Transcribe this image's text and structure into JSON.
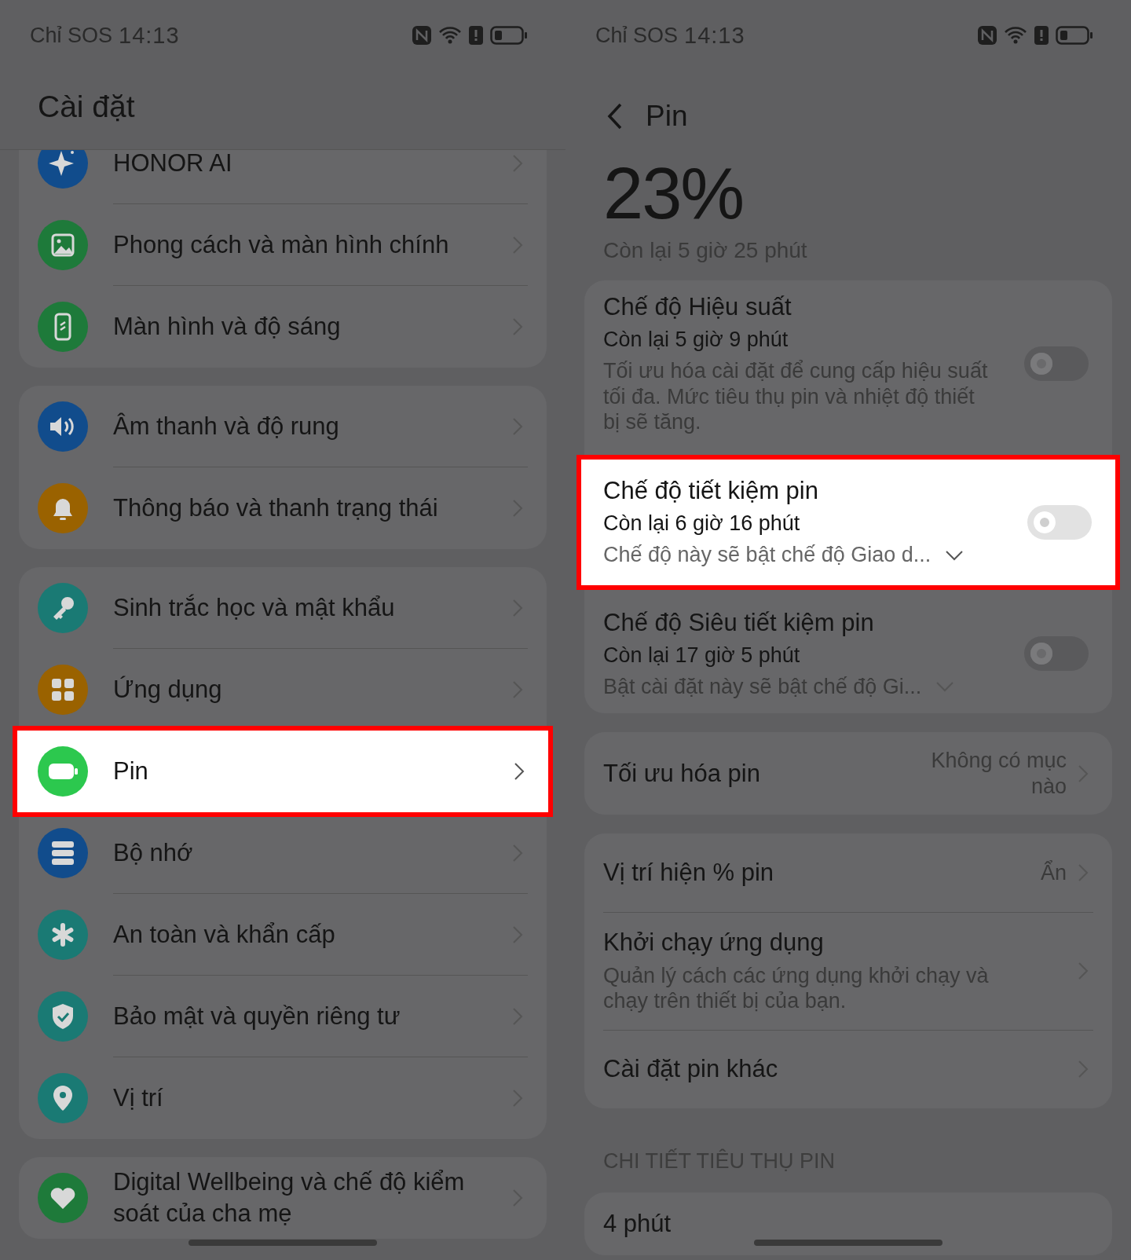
{
  "left": {
    "status": {
      "carrier": "Chỉ SOS",
      "time": "14:13"
    },
    "title": "Cài đặt",
    "groups": [
      {
        "items": [
          {
            "label": "HONOR AI",
            "kind": "sparkle",
            "color": "#114c8c",
            "highlighted": false
          },
          {
            "label": "Phong cách và màn hình chính",
            "kind": "image",
            "color": "#1e7a3a",
            "highlighted": false
          },
          {
            "label": "Màn hình và độ sáng",
            "kind": "phone",
            "color": "#1e7a3a",
            "highlighted": false
          }
        ]
      },
      {
        "items": [
          {
            "label": "Âm thanh và độ rung",
            "kind": "speaker",
            "color": "#114c8c",
            "highlighted": false
          },
          {
            "label": "Thông báo và thanh trạng thái",
            "kind": "bell",
            "color": "#9a6200",
            "highlighted": false
          }
        ]
      },
      {
        "items": [
          {
            "label": "Sinh trắc học và mật khẩu",
            "kind": "key",
            "color": "#1a7a74",
            "highlighted": false
          },
          {
            "label": "Ứng dụng",
            "kind": "grid",
            "color": "#9a6200",
            "highlighted": false
          },
          {
            "label": "Pin",
            "kind": "battery",
            "color": "#2cc84e",
            "highlighted": true
          },
          {
            "label": "Bộ nhớ",
            "kind": "storage",
            "color": "#114c8c",
            "highlighted": false
          },
          {
            "label": "An toàn và khẩn cấp",
            "kind": "asterisk",
            "color": "#1a7a74",
            "highlighted": false
          },
          {
            "label": "Bảo mật và quyền riêng tư",
            "kind": "shield",
            "color": "#1a7a74",
            "highlighted": false
          },
          {
            "label": "Vị trí",
            "kind": "pin",
            "color": "#1a7a74",
            "highlighted": false
          }
        ]
      },
      {
        "items": [
          {
            "label": "Digital Wellbeing và chế độ kiểm soát của cha mẹ",
            "kind": "heart",
            "color": "#1e7a3a",
            "highlighted": false
          }
        ]
      }
    ]
  },
  "right": {
    "status": {
      "carrier": "Chỉ SOS",
      "time": "14:13"
    },
    "title": "Pin",
    "percent": "23%",
    "remaining": "Còn lại 5 giờ 25 phút",
    "modes": [
      {
        "title": "Chế độ Hiệu suất",
        "remaining": "Còn lại 5 giờ 9 phút",
        "description": "Tối ưu hóa cài đặt để cung cấp hiệu suất tối đa. Mức tiêu thụ pin và nhiệt độ thiết bị sẽ tăng.",
        "expandable": false,
        "on": false,
        "highlighted": false
      },
      {
        "title": "Chế độ tiết kiệm pin",
        "remaining": "Còn lại 6 giờ 16 phút",
        "description": "Chế độ này sẽ bật chế độ Giao d...",
        "expandable": true,
        "on": false,
        "highlighted": true
      },
      {
        "title": "Chế độ Siêu tiết kiệm pin",
        "remaining": "Còn lại 17 giờ 5 phút",
        "description": "Bật cài đặt này sẽ bật chế độ Gi...",
        "expandable": true,
        "on": false,
        "highlighted": false
      }
    ],
    "cards": [
      {
        "rows": [
          {
            "kind": "value",
            "label": "Tối ưu hóa pin",
            "value": "Không có mục nào"
          }
        ]
      },
      {
        "rows": [
          {
            "kind": "value",
            "label": "Vị trí hiện % pin",
            "value": "Ẩn"
          },
          {
            "kind": "description",
            "label": "Khởi chạy ứng dụng",
            "description": "Quản lý cách các ứng dụng khởi chạy và chạy trên thiết bị của bạn."
          },
          {
            "kind": "plain",
            "label": "Cài đặt pin khác"
          }
        ]
      }
    ],
    "section": "CHI TIẾT TIÊU THỤ PIN",
    "usage": "4 phút"
  }
}
